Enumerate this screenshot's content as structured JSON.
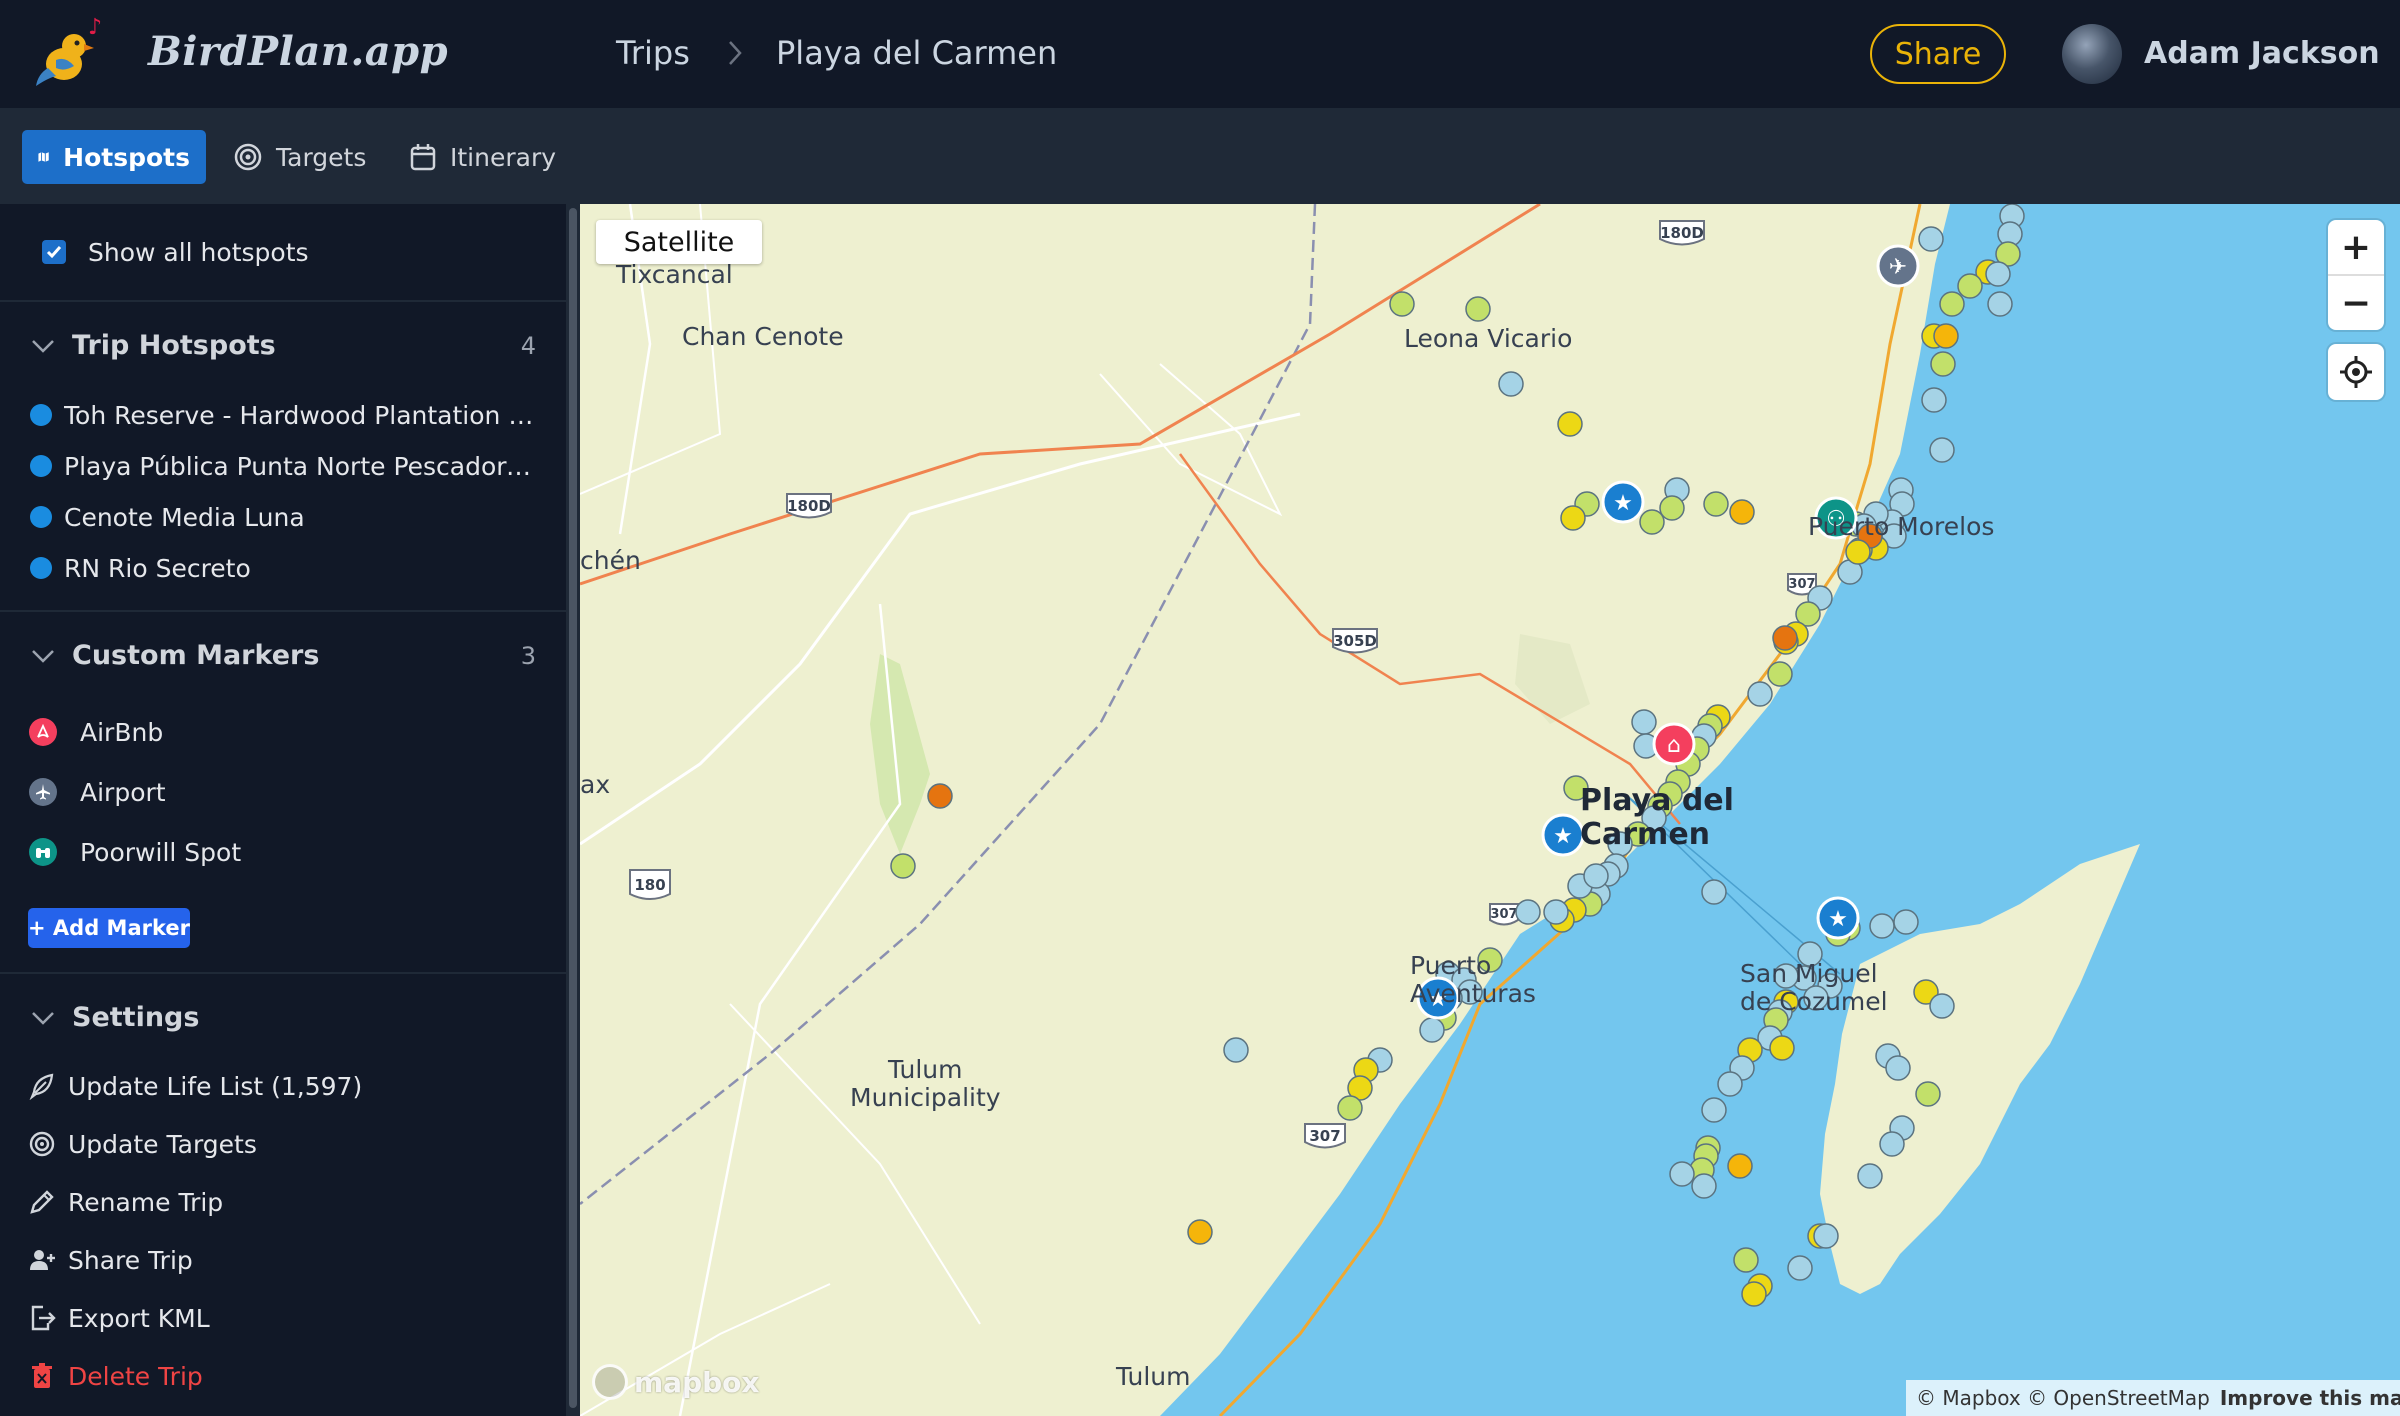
{
  "app": {
    "logo_text": "BirdPlan.app"
  },
  "breadcrumb": {
    "root": "Trips",
    "current": "Playa del Carmen"
  },
  "header": {
    "share_label": "Share",
    "user_name": "Adam Jackson"
  },
  "tabs": [
    {
      "label": "Hotspots",
      "icon": "map-icon",
      "active": true
    },
    {
      "label": "Targets",
      "icon": "target-icon",
      "active": false
    },
    {
      "label": "Itinerary",
      "icon": "calendar-icon",
      "active": false
    }
  ],
  "sidebar": {
    "show_all_label": "Show all hotspots",
    "show_all_checked": true,
    "trip_hotspots": {
      "title": "Trip Hotspots",
      "count": "4",
      "items": [
        {
          "label": "Toh Reserve - Hardwood Plantation and Trail"
        },
        {
          "label": "Playa Pública Punta Norte Pescadores"
        },
        {
          "label": "Cenote Media Luna"
        },
        {
          "label": "RN Rio Secreto"
        }
      ]
    },
    "custom_markers": {
      "title": "Custom Markers",
      "count": "3",
      "items": [
        {
          "label": "AirBnb",
          "icon": "airbnb-icon",
          "color": "#f43f5e"
        },
        {
          "label": "Airport",
          "icon": "airplane-icon",
          "color": "#64748b"
        },
        {
          "label": "Poorwill Spot",
          "icon": "binoculars-icon",
          "color": "#0d9488"
        }
      ],
      "add_label": "+ Add Marker"
    },
    "settings": {
      "title": "Settings",
      "items": [
        {
          "label": "Update Life List (1,597)",
          "icon": "feather-icon"
        },
        {
          "label": "Update Targets",
          "icon": "target-icon"
        },
        {
          "label": "Rename Trip",
          "icon": "pencil-icon"
        },
        {
          "label": "Share Trip",
          "icon": "user-plus-icon"
        },
        {
          "label": "Export KML",
          "icon": "export-icon"
        },
        {
          "label": "Delete Trip",
          "icon": "trash-icon",
          "danger": true
        }
      ]
    }
  },
  "map": {
    "satellite_label": "Satellite",
    "zoom_in": "+",
    "zoom_out": "−",
    "attribution_mapbox": "© Mapbox",
    "attribution_osm": "© OpenStreetMap",
    "attribution_improve": "Improve this map",
    "logo_label": "mapbox",
    "labels": {
      "tixcancal": "Tixcancal",
      "chan_cenote": "Chan Cenote",
      "leona_vicario": "Leona Vicario",
      "chen": "chén",
      "ax": "ax",
      "playa_l1": "Playa del",
      "playa_l2": "Carmen",
      "puerto_l1": "Puerto",
      "puerto_l2": "Aventuras",
      "cozumel_l1": "San Miguel",
      "cozumel_l2": "de Cozumel",
      "morelos": "Puerto Morelos",
      "tulum_muni_l1": "Tulum",
      "tulum_muni_l2": "Municipality",
      "tulum": "Tulum"
    },
    "shields": [
      "180D",
      "180D",
      "305D",
      "307",
      "307",
      "307",
      "180"
    ],
    "colors": {
      "land": "#eef0d0",
      "water": "#73c6ee",
      "highway": "#f0834f",
      "road": "#ffffff",
      "hotspot_lightblue": "#a5d3e6",
      "hotspot_greenyellow": "#c2e06a",
      "hotspot_yellow": "#ecd815",
      "hotspot_orange": "#f5b50a",
      "hotspot_darkorange": "#e57410",
      "trip_star": "#1a7fd0",
      "airbnb": "#f43f5e",
      "airport": "#64748b",
      "poorwill": "#0d9488"
    }
  }
}
